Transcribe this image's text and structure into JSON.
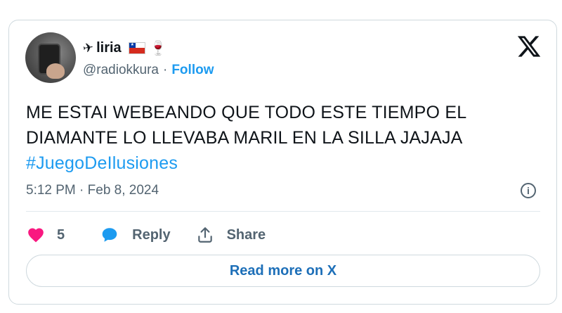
{
  "author": {
    "display_name": "liria",
    "name_prefix_icon": "airplane-icon",
    "name_suffix_icons": [
      "chile-flag-icon",
      "wine-glass-icon"
    ],
    "handle": "@radiokkura",
    "separator": "·",
    "follow_label": "Follow"
  },
  "tweet": {
    "text_line1": "ME ESTAI WEBEANDO QUE TODO ESTE TIEMPO EL",
    "text_line2": "DIAMANTE LO LLEVABA MARIL EN LA SILLA JAJAJA",
    "hashtag": "#JuegoDeIlusiones",
    "timestamp": "5:12 PM · Feb 8, 2024"
  },
  "actions": {
    "like_count": "5",
    "reply_label": "Reply",
    "share_label": "Share"
  },
  "read_more_label": "Read more on X",
  "colors": {
    "accent": "#1d9bf0",
    "like": "#f91880",
    "reply_icon": "#1d9bf0",
    "muted": "#536471",
    "border": "#cfd9de"
  }
}
